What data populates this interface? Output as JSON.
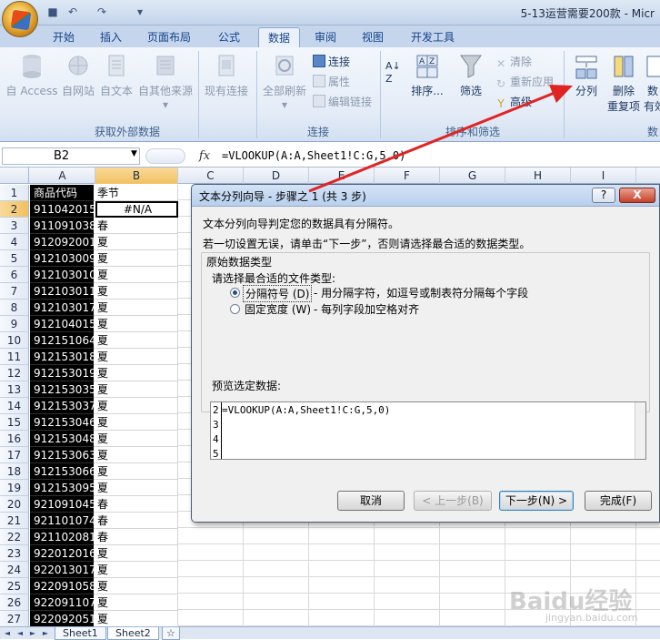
{
  "window": {
    "title": "5-13运营需要200款 - Micr"
  },
  "tabs": [
    "开始",
    "插入",
    "页面布局",
    "公式",
    "数据",
    "审阅",
    "视图",
    "开发工具"
  ],
  "ribbon": {
    "external": {
      "label": "获取外部数据",
      "access": "自 Access",
      "web": "自网站",
      "text": "自文本",
      "other": "自其他来源",
      "existing": "现有连接"
    },
    "connections": {
      "label": "连接",
      "refresh_all": "全部刷新",
      "connections": "连接",
      "properties": "属性",
      "edit_links": "编辑链接"
    },
    "sort_filter": {
      "label": "排序和筛选",
      "sort": "排序...",
      "filter": "筛选",
      "clear": "清除",
      "reapply": "重新应用",
      "advanced": "高级"
    },
    "data_tools": {
      "split": "分列",
      "remove_dup_1": "删除",
      "remove_dup_2": "重复项",
      "validate_1": "数",
      "validate_2": "有效",
      "label": "数"
    }
  },
  "formula_bar": {
    "cell": "B2",
    "fx": "fx",
    "formula": "=VLOOKUP(A:A,Sheet1!C:G,5,0)"
  },
  "columns": [
    "A",
    "B",
    "C",
    "D",
    "E",
    "F",
    "G",
    "H",
    "I"
  ],
  "rows": [
    {
      "n": "1",
      "a": "商品代码",
      "b": "季节"
    },
    {
      "n": "2",
      "a": "911042015",
      "b": "#N/A"
    },
    {
      "n": "3",
      "a": "911091038",
      "b": "春"
    },
    {
      "n": "4",
      "a": "912092001",
      "b": "夏"
    },
    {
      "n": "5",
      "a": "912103009",
      "b": "夏"
    },
    {
      "n": "6",
      "a": "912103010",
      "b": "夏"
    },
    {
      "n": "7",
      "a": "912103011",
      "b": "夏"
    },
    {
      "n": "8",
      "a": "912103017",
      "b": "夏"
    },
    {
      "n": "9",
      "a": "912104015",
      "b": "夏"
    },
    {
      "n": "10",
      "a": "912151064",
      "b": "夏"
    },
    {
      "n": "11",
      "a": "912153018",
      "b": "夏"
    },
    {
      "n": "12",
      "a": "912153019",
      "b": "夏"
    },
    {
      "n": "13",
      "a": "912153035",
      "b": "夏"
    },
    {
      "n": "14",
      "a": "912153037",
      "b": "夏"
    },
    {
      "n": "15",
      "a": "912153046",
      "b": "夏"
    },
    {
      "n": "16",
      "a": "912153048",
      "b": "夏"
    },
    {
      "n": "17",
      "a": "912153063",
      "b": "夏"
    },
    {
      "n": "18",
      "a": "912153066",
      "b": "夏"
    },
    {
      "n": "19",
      "a": "912153095",
      "b": "夏"
    },
    {
      "n": "20",
      "a": "921091045",
      "b": "春"
    },
    {
      "n": "21",
      "a": "921101074",
      "b": "春"
    },
    {
      "n": "22",
      "a": "921102081",
      "b": "春"
    },
    {
      "n": "23",
      "a": "922012016",
      "b": "夏"
    },
    {
      "n": "24",
      "a": "922013017",
      "b": "夏"
    },
    {
      "n": "25",
      "a": "922091058",
      "b": "夏"
    },
    {
      "n": "26",
      "a": "922091107",
      "b": "夏"
    },
    {
      "n": "27",
      "a": "922092051",
      "b": "夏"
    }
  ],
  "sheets": [
    "Sheet1",
    "Sheet2"
  ],
  "dialog": {
    "title": "文本分列向导 - 步骤之 1 (共 3 步)",
    "help": "?",
    "close": "X",
    "line1": "文本分列向导判定您的数据具有分隔符。",
    "line2": "若一切设置无误，请单击“下一步”，否则请选择最合适的数据类型。",
    "group_title": "原始数据类型",
    "prompt": "请选择最合适的文件类型:",
    "opt1_label": "分隔符号 (D)",
    "opt1_desc": "- 用分隔字符，如逗号或制表符分隔每个字段",
    "opt2_label": "固定宽度 (W)",
    "opt2_desc": "- 每列字段加空格对齐",
    "preview_label": "预览选定数据:",
    "preview_nums": [
      "2",
      "3",
      "4",
      "5"
    ],
    "preview_lines": [
      "=VLOOKUP(A:A,Sheet1!C:G,5,0)",
      "",
      "",
      ""
    ],
    "btn_cancel": "取消",
    "btn_prev": "< 上一步(B)",
    "btn_next": "下一步(N) >",
    "btn_finish": "完成(F)"
  },
  "watermark": {
    "brand": "Baidu经验",
    "url": "jingyan.baidu.com"
  }
}
